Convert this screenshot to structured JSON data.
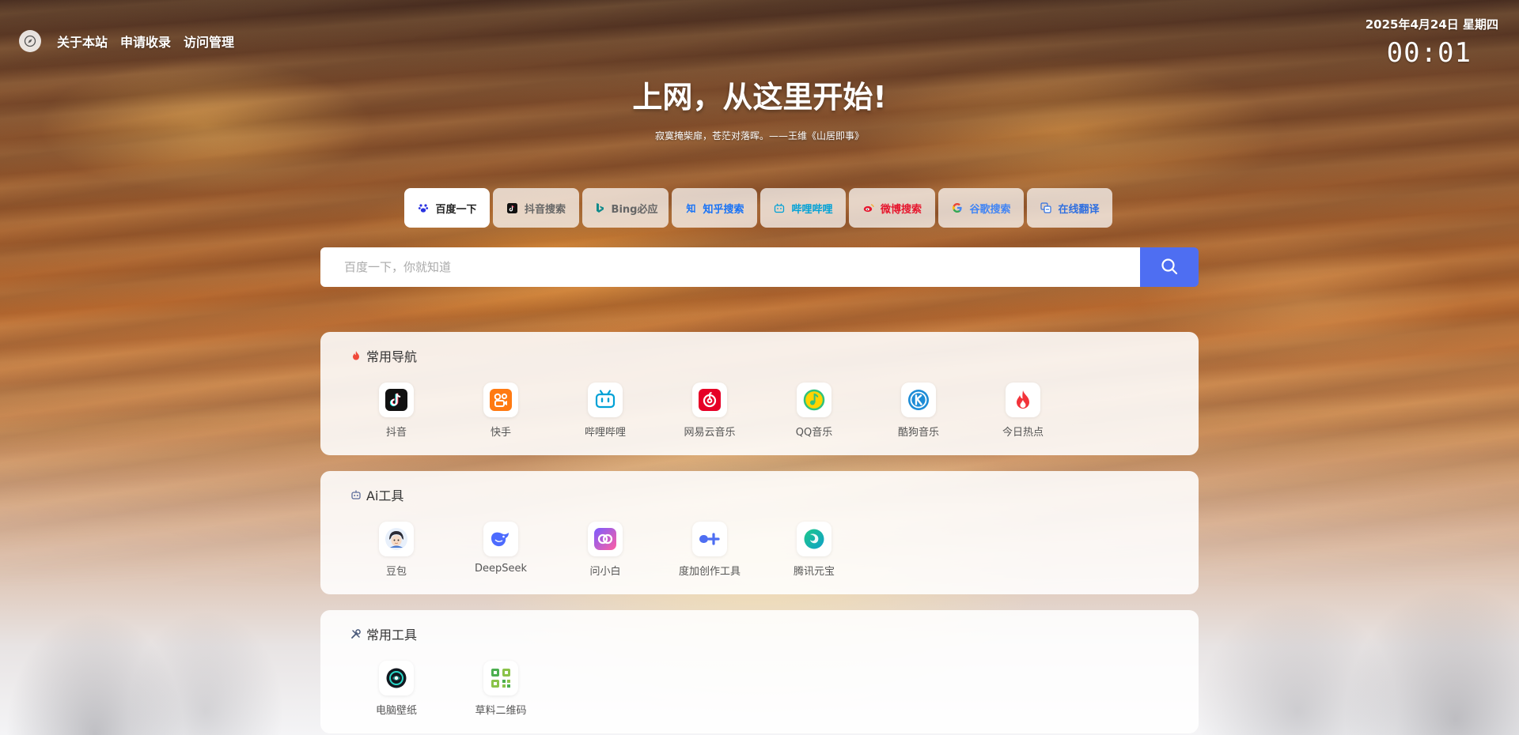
{
  "nav": {
    "logo_icon": "compass-icon",
    "links": [
      "关于本站",
      "申请收录",
      "访问管理"
    ]
  },
  "clock": {
    "date": "2025年4月24日 星期四",
    "time": "00:01"
  },
  "hero": {
    "title": "上网，从这里开始!",
    "subtitle": "寂寞掩柴扉，苍茫对落晖。——王维《山居即事》"
  },
  "engines": [
    {
      "label": "百度一下",
      "icon": "baidu-paw-icon",
      "color": "#2932e1",
      "active": true
    },
    {
      "label": "抖音搜索",
      "icon": "douyin-icon",
      "color": "#000000",
      "active": false
    },
    {
      "label": "Bing必应",
      "icon": "bing-icon",
      "color": "#0f8a8a",
      "active": false
    },
    {
      "label": "知乎搜索",
      "icon": "zhihu-icon",
      "color": "#1772f6",
      "active": false
    },
    {
      "label": "哔哩哔哩",
      "icon": "bilibili-icon",
      "color": "#00a1d6",
      "active": false
    },
    {
      "label": "微博搜索",
      "icon": "weibo-icon",
      "color": "#e6162d",
      "active": false
    },
    {
      "label": "谷歌搜索",
      "icon": "google-icon",
      "color": "#4285f4",
      "active": false
    },
    {
      "label": "在线翻译",
      "icon": "translate-icon",
      "color": "#2f6fe0",
      "active": false
    }
  ],
  "search": {
    "placeholder": "百度一下，你就知道",
    "value": "",
    "button_color": "#4e6ef2"
  },
  "sections": [
    {
      "title": "常用导航",
      "icon": "fire-icon",
      "items": [
        {
          "label": "抖音",
          "icon": "douyin-app-icon"
        },
        {
          "label": "快手",
          "icon": "kuaishou-app-icon"
        },
        {
          "label": "哔哩哔哩",
          "icon": "bilibili-app-icon"
        },
        {
          "label": "网易云音乐",
          "icon": "netease-music-app-icon"
        },
        {
          "label": "QQ音乐",
          "icon": "qq-music-app-icon"
        },
        {
          "label": "酷狗音乐",
          "icon": "kugou-music-app-icon"
        },
        {
          "label": "今日热点",
          "icon": "hot-flame-app-icon"
        }
      ]
    },
    {
      "title": "Ai工具",
      "icon": "robot-icon",
      "items": [
        {
          "label": "豆包",
          "icon": "doubao-app-icon"
        },
        {
          "label": "DeepSeek",
          "icon": "deepseek-app-icon"
        },
        {
          "label": "问小白",
          "icon": "wenxiaobai-app-icon"
        },
        {
          "label": "度加创作工具",
          "icon": "dujia-app-icon"
        },
        {
          "label": "腾讯元宝",
          "icon": "yuanbao-app-icon"
        }
      ]
    },
    {
      "title": "常用工具",
      "icon": "tools-icon",
      "items": [
        {
          "label": "电脑壁纸",
          "icon": "wallpaper-app-icon"
        },
        {
          "label": "草料二维码",
          "icon": "qrcode-app-icon"
        }
      ]
    }
  ]
}
